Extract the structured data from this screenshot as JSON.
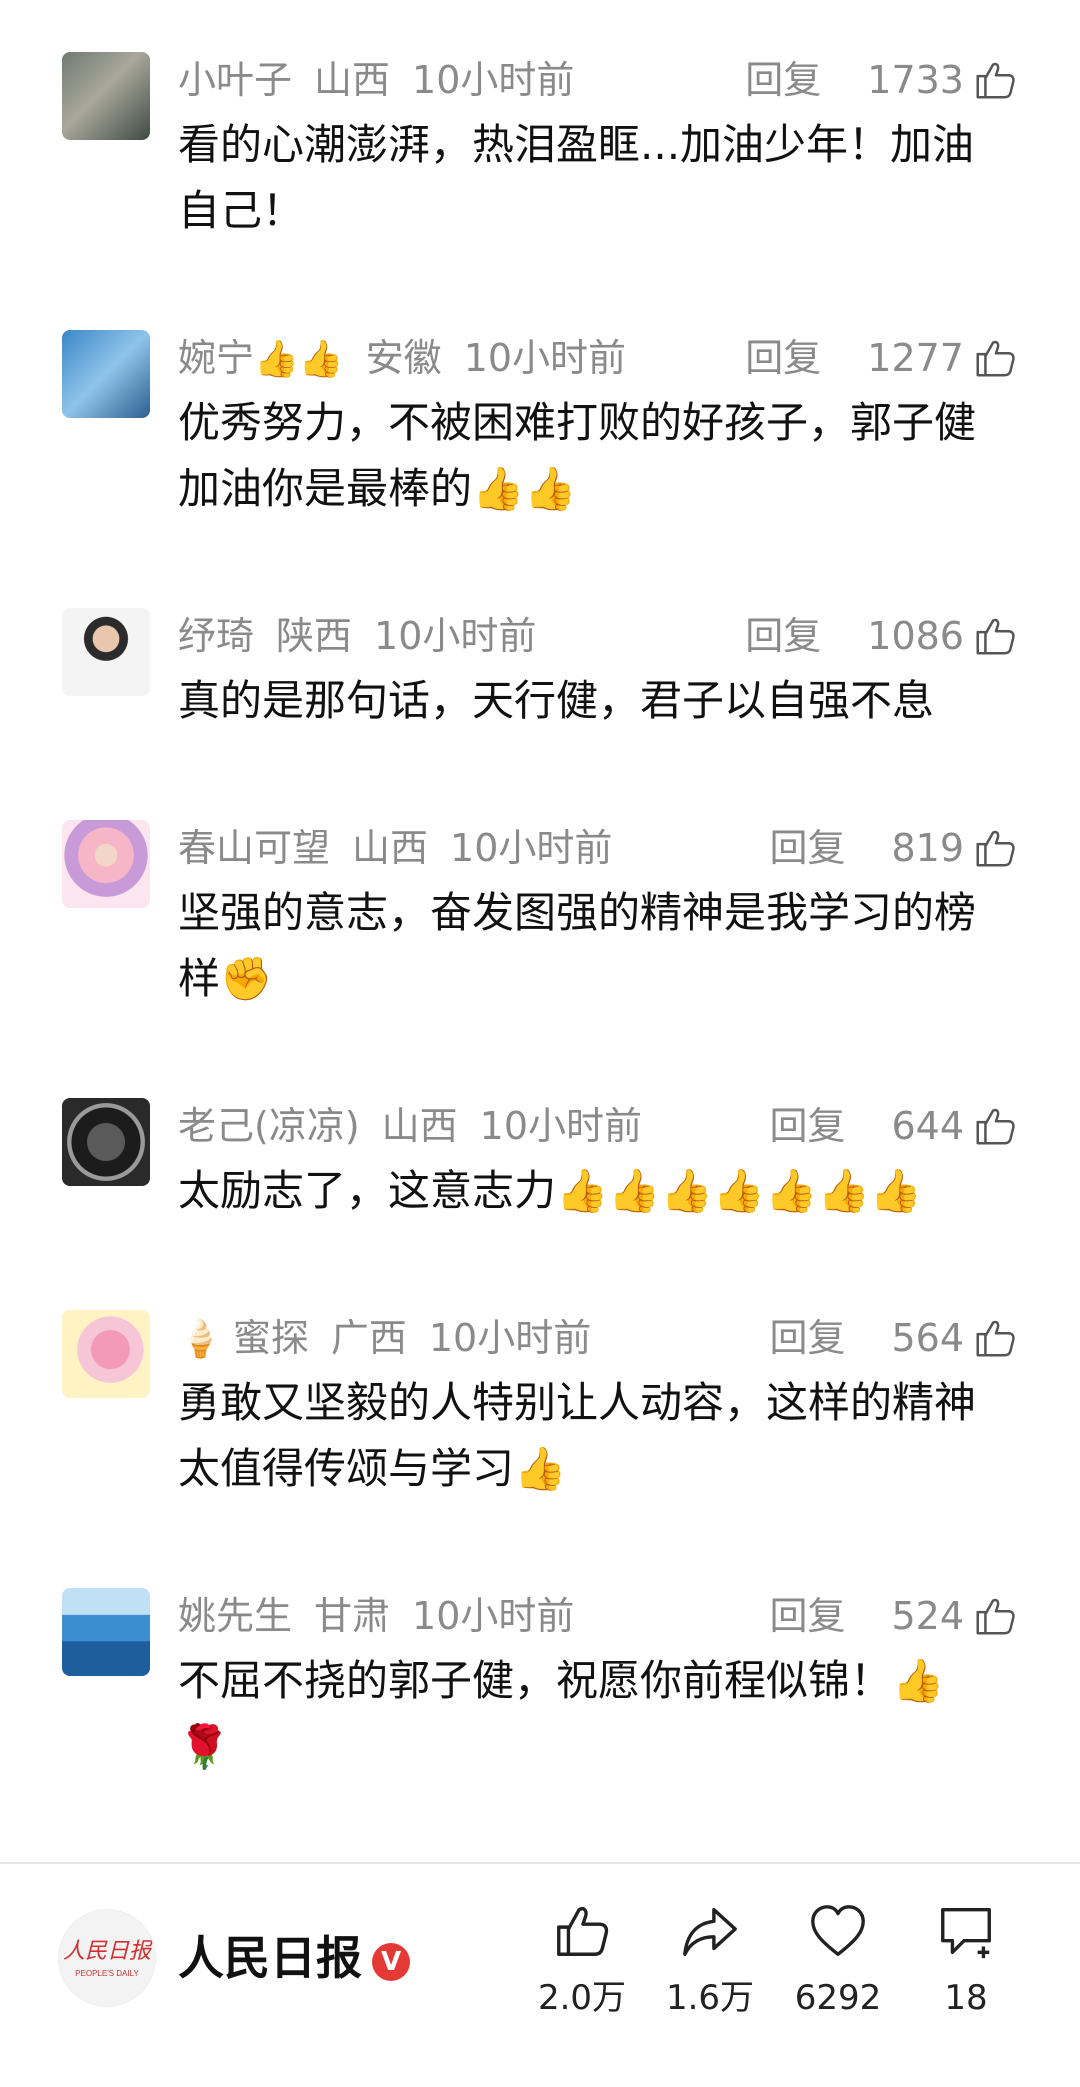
{
  "comments": [
    {
      "user": "小叶子",
      "flair": "",
      "region": "山西",
      "time": "10小时前",
      "reply": "回复",
      "likes": "1733",
      "text": "看的心潮澎湃，热泪盈眶...加油少年！加油\n自己！"
    },
    {
      "user": "婉宁",
      "flair": "👍👍",
      "region": "安徽",
      "time": "10小时前",
      "reply": "回复",
      "likes": "1277",
      "text": "优秀努力，不被困难打败的好孩子，郭子健\n加油你是最棒的👍👍"
    },
    {
      "user": "纾琦",
      "flair": "",
      "region": "陕西",
      "time": "10小时前",
      "reply": "回复",
      "likes": "1086",
      "text": "真的是那句话，天行健，君子以自强不息"
    },
    {
      "user": "春山可望",
      "flair": "",
      "region": "山西",
      "time": "10小时前",
      "reply": "回复",
      "likes": "819",
      "text": "坚强的意志，奋发图强的精神是我学习的榜\n样✊"
    },
    {
      "user": "老己(凉凉)",
      "flair": "",
      "region": "山西",
      "time": "10小时前",
      "reply": "回复",
      "likes": "644",
      "text": "太励志了，这意志力👍👍👍👍👍👍👍"
    },
    {
      "user": "蜜探",
      "flair": "🍦",
      "region": "广西",
      "time": "10小时前",
      "reply": "回复",
      "likes": "564",
      "text": "勇敢又坚毅的人特别让人动容，这样的精神\n太值得传颂与学习👍"
    },
    {
      "user": "姚先生",
      "flair": "",
      "region": "甘肃",
      "time": "10小时前",
      "reply": "回复",
      "likes": "524",
      "text": "不屈不挠的郭子健，祝愿你前程似锦！👍\n🌹"
    }
  ],
  "bottom": {
    "publisher": "人民日报",
    "verified_mark": "V",
    "logo_text": "人民日报",
    "logo_sub": "PEOPLE'S DAILY",
    "actions": [
      {
        "icon": "thumbs-up-icon",
        "count": "2.0万"
      },
      {
        "icon": "share-icon",
        "count": "1.6万"
      },
      {
        "icon": "heart-icon",
        "count": "6292"
      },
      {
        "icon": "comment-plus-icon",
        "count": "18"
      }
    ]
  }
}
